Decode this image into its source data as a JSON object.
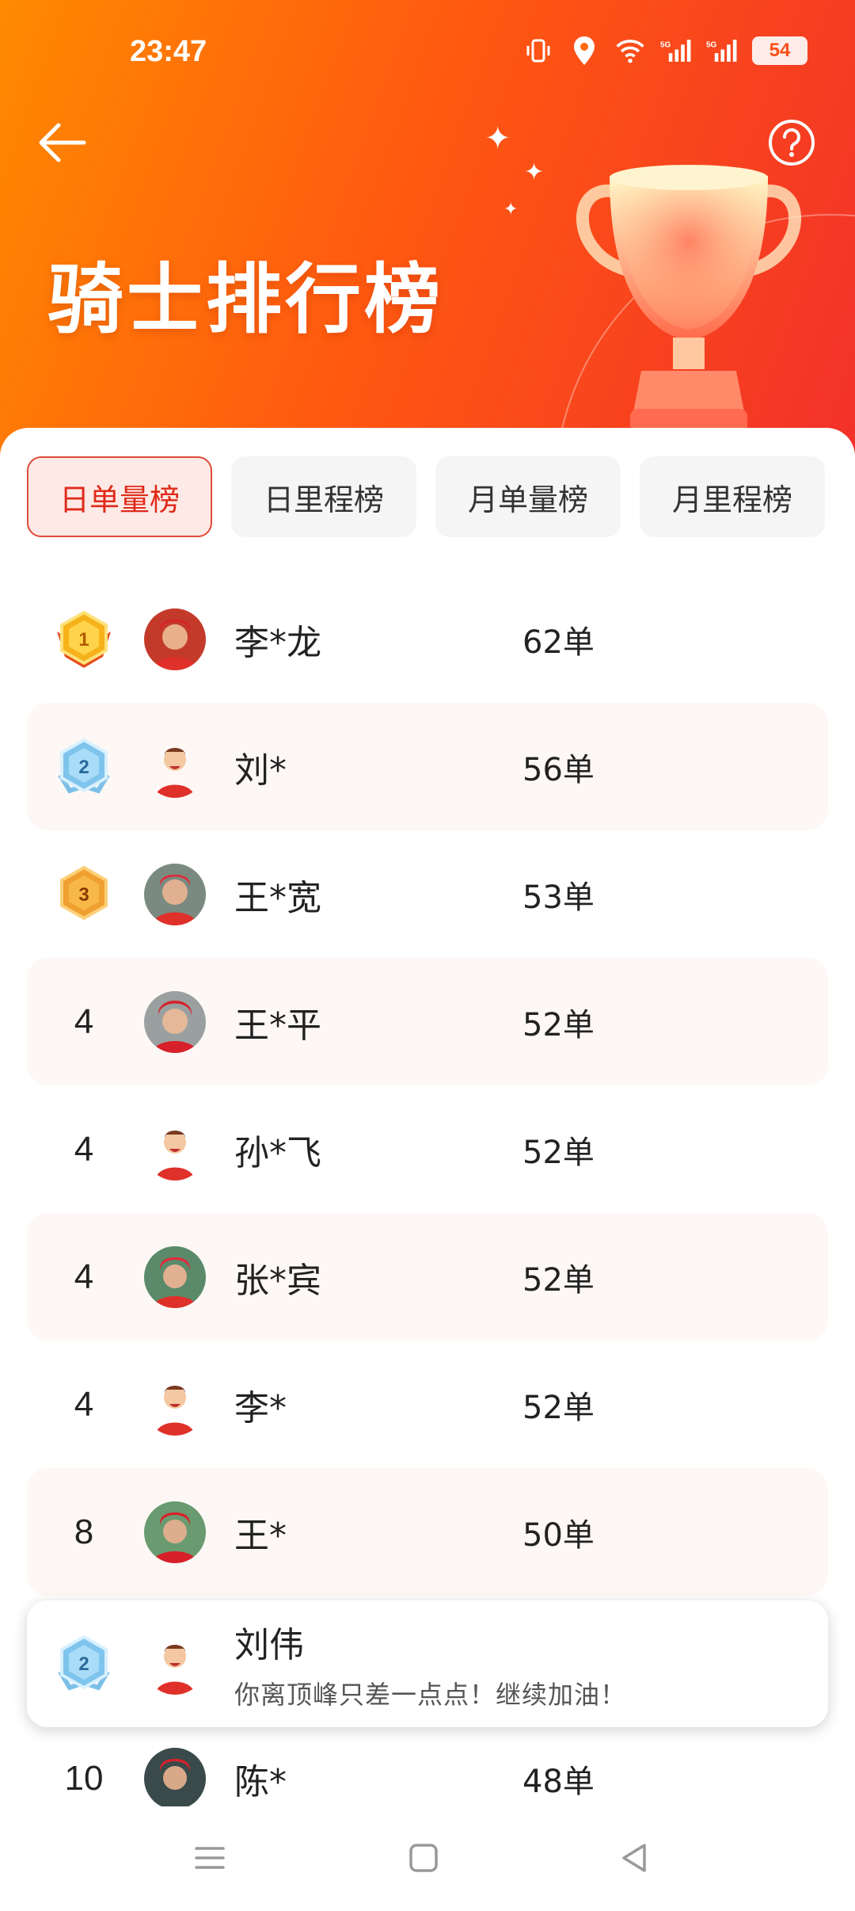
{
  "status_bar": {
    "time": "23:47",
    "battery": "54"
  },
  "header": {
    "title": "骑士排行榜"
  },
  "tabs": [
    {
      "label": "日单量榜",
      "active": true
    },
    {
      "label": "日里程榜",
      "active": false
    },
    {
      "label": "月单量榜",
      "active": false
    },
    {
      "label": "月里程榜",
      "active": false
    }
  ],
  "ranking": [
    {
      "rank": "1",
      "medal": "gold-medal-icon",
      "name": "李*龙",
      "orders": "62单",
      "avatar": "photo"
    },
    {
      "rank": "2",
      "medal": "silver-medal-icon",
      "name": "刘*",
      "orders": "56单",
      "avatar": "cartoon"
    },
    {
      "rank": "3",
      "medal": "bronze-medal-icon",
      "name": "王*宽",
      "orders": "53单",
      "avatar": "photo"
    },
    {
      "rank": "4",
      "name": "王*平",
      "orders": "52单",
      "avatar": "photo"
    },
    {
      "rank": "4",
      "name": "孙*飞",
      "orders": "52单",
      "avatar": "cartoon"
    },
    {
      "rank": "4",
      "name": "张*宾",
      "orders": "52单",
      "avatar": "photo"
    },
    {
      "rank": "4",
      "name": "李*",
      "orders": "52单",
      "avatar": "cartoon"
    },
    {
      "rank": "8",
      "name": "王*",
      "orders": "50单",
      "avatar": "photo"
    }
  ],
  "my_rank": {
    "rank": "2",
    "name": "刘伟",
    "message": "你离顶峰只差一点点！继续加油！"
  },
  "partial_row": {
    "rank": "10",
    "name": "陈*",
    "orders": "48单"
  },
  "colors": {
    "accent": "#e02a1a",
    "header_start": "#ff8a00",
    "header_end": "#f2302a"
  }
}
